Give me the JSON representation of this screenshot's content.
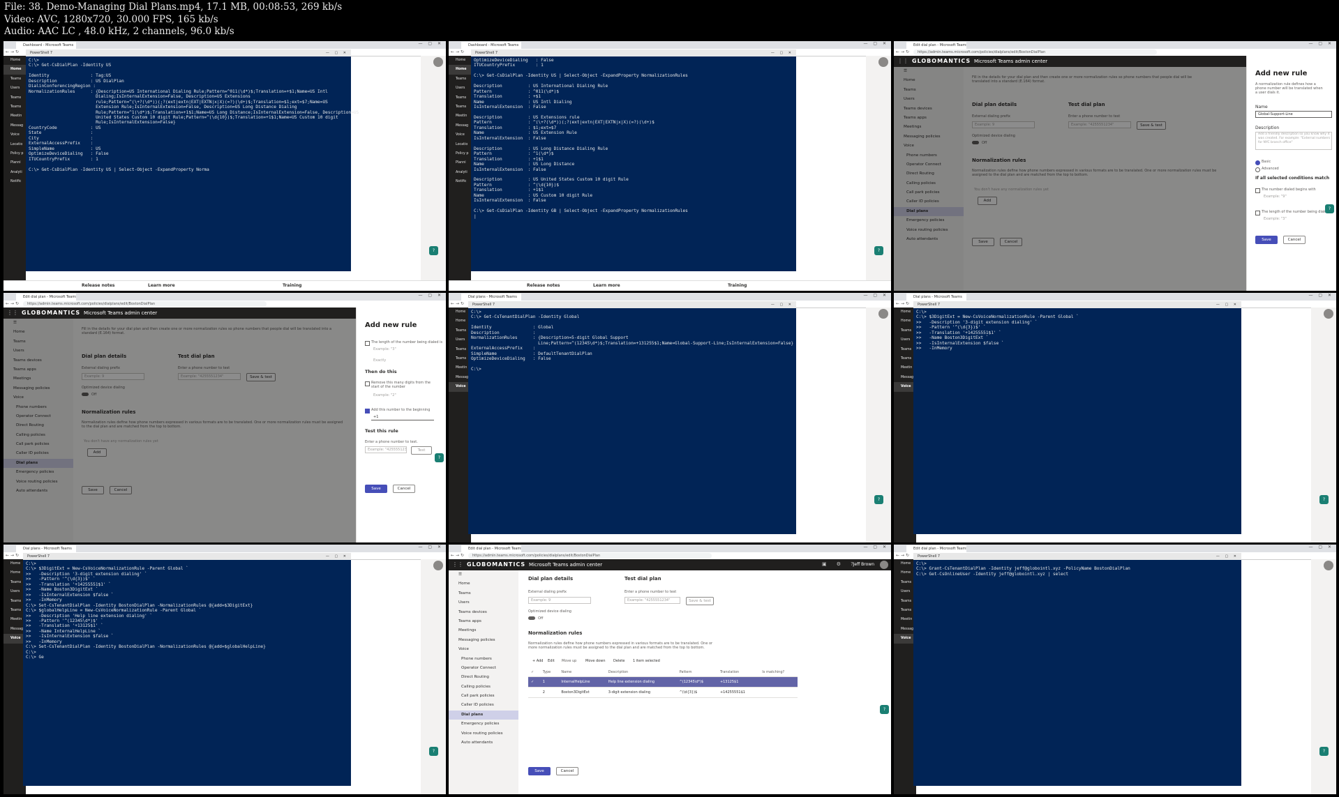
{
  "file_info": {
    "line1": "File: 38. Demo-Managing Dial Plans.mp4, 17.1 MB, 00:08:53, 269 kb/s",
    "line2": "Video: AVC, 1280x720, 30.000 FPS, 165 kb/s",
    "line3": "Audio: AAC LC , 48.0 kHz, 2 channels, 96.0 kb/s"
  },
  "browser": {
    "tab_dashboard": "Dashboard - Microsoft Teams",
    "tab_edit": "Edit dial plan - Microsoft Teams",
    "tab_dialplans": "Dial plans - Microsoft Teams",
    "url": "https://admin.teams.microsoft.com/policies/dialplans/edit/BostonDialPlan",
    "powershell_tab": "PowerShell 7"
  },
  "teams": {
    "brand": "GLOBOMANTICS",
    "app_title": "Microsoft Teams admin center",
    "user": "Jeff Brown"
  },
  "sidebar_items": [
    "Home",
    "Teams",
    "Users",
    "Teams devices",
    "Teams apps",
    "Meetings",
    "Messaging policies",
    "Voice",
    "Phone numbers",
    "Operator Connect",
    "Direct Routing",
    "Calling policies",
    "Call park policies",
    "Caller ID policies",
    "Dial plans",
    "Emergency policies",
    "Voice routing policies",
    "Auto attendants"
  ],
  "ps_left_items": [
    "Home",
    "Teams",
    "Users",
    "Teams",
    "Teams",
    "Meetin",
    "Messag",
    "Voice",
    "Locatio",
    "Policy p",
    "Planni",
    "Analyti",
    "Notific"
  ],
  "bottom_links": {
    "release_notes": "Release notes",
    "learn_more": "Learn more",
    "training": "Training"
  },
  "ps1": "C:\\>\nC:\\> Get-CsDialPlan -Identity US\n\nIdentity                : Tag:US\nDescription             : US DialPlan\nDialinConferencingRegion :\nNormalizationRules      : {Description=US International Dialing Rule;Pattern=^011(\\d*)$;Translation=+$1;Name=US Intl\n                          Dialing;IsInternalExtension=False, Description=US Extensions\n                          rule;Pattern=^(\\+?(\\d*))(;?(ext|extn|EXT|EXTN|x|X)(=?)(\\d+)$;Translation=$1;ext=$7;Name=US\n                          Extension Rule;IsInternalExtension=False, Description=US Long Distance Dialing\n                          Rule;Pattern=^1(\\d*)$;Translation=+1$1;Name=US Long Distance;IsInternalExtension=False, Description=US\n                          United States Custom 10 digit Rule;Pattern=^(\\d{10})$;Translation=+1$1;Name=US Custom 10 digit\n                          Rule;IsInternalExtension=False}\nCountryCode             : US\nState                   :\nCity                    :\nExternalAccessPrefix    :\nSimpleName              : US\nOptimizeDeviceDialing   : False\nITUCountryPrefix        : 1\n\nC:\\> Get-CsDialPlan -Identity US | Select-Object -ExpandProperty Norma",
  "ps2": "OptimizeDeviceDialing   : False\nITUCountryPrefix        : 1\n\nC:\\> Get-CsDialPlan -Identity US | Select-Object -ExpandProperty NormalizationRules\n\nDescription          : US International Dialing Rule\nPattern              : ^011(\\d*)$\nTranslation          : +$1\nName                 : US Intl Dialing\nIsInternalExtension  : False\n\nDescription          : US Extensions rule\nPattern              : ^(\\+?(\\d*))(;?(ext|extn|EXT|EXTN|x|X)(=?)(\\d+)$\nTranslation          : $1;ext=$7\nName                 : US Extension Rule\nIsInternalExtension  : False\n\nDescription          : US Long Distance Dialing Rule\nPattern              : ^1(\\d*)$\nTranslation          : +1$1\nName                 : US Long Distance\nIsInternalExtension  : False\n\nDescription          : US United States Custom 10 digit Rule\nPattern              : ^(\\d{10})$\nTranslation          : +1$1\nName                 : US Custom 10 digit Rule\nIsInternalExtension  : False\n\nC:\\> Get-CsDialPlan -Identity GB | Select-Object -ExpandProperty NormalizationRules\n|",
  "ps5": "C:\\>\nC:\\> Get-CsTenantDialPlan -Identity Global\n\nIdentity                : Global\nDescription             :\nNormalizationRules      : {Description=5-digit Global Support\n                          Line;Pattern=^(12345\\d*)$;Translation=+131255$1;Name=Global-Support-Line;IsInternalExtension=False}\nExternalAccessPrefix    :\nSimpleName              : DefaultTenantDialPlan\nOptimizeDeviceDialing   : False\n\nC:\\>",
  "ps6": "C:\\>\nC:\\> $3DigitExt = New-CsVoiceNormalizationRule -Parent Global `\n>>   -Description '3-digit extension dialing' `\n>>   -Pattern '^(\\d{3})$' `\n>>   -Translation '+14255551$1' `\n>>   -Name Boston3DigitExt `\n>>   -IsInternalExtension $false `\n>>   -InMemory",
  "ps7": "C:\\>\nC:\\> $3DigitExt = New-CsVoiceNormalizationRule -Parent Global `\n>>   -Description '3-digit extension dialing' `\n>>   -Pattern '^(\\d{3})$' `\n>>   -Translation '+14255551$1' `\n>>   -Name Boston3DigitExt `\n>>   -IsInternalExtension $false `\n>>   -InMemory\nC:\\> Set-CsTenantDialPlan -Identity BostonDialPlan -NormalizationRules @{add=$3DigitExt}\nC:\\> $globalHelpLine = New-CsVoiceNormalizationRule -Parent Global `\n>>   -Description 'Help line extension dialing' `\n>>   -Pattern '^(12345\\d*)$' `\n>>   -Translation '+13125$1' `\n>>   -Name InternalHelpLine `\n>>   -IsInternalExtension $false `\n>>   -InMemory\nC:\\> Set-CsTenantDialPlan -Identity BostonDialPlan -NormalizationRules @{add=$globalHelpLine}\nC:\\>\nC:\\> Ge",
  "ps9": "C:\\>\nC:\\> Grant-CsTenantDialPlan -Identity jeff@globointl.xyz -PolicyName BostonDialPlan\nC:\\> Get-CsOnlineUser -Identity jeff@globointl.xyz | select",
  "admin": {
    "intro": "Fill in the details for your dial plan and then create one or more normalization rules so phone numbers that people dial will be translated into a standard (E.164) format.",
    "learn_more": "Learn more",
    "dial_plan_details": "Dial plan details",
    "ext_prefix_label": "External dialing prefix",
    "ext_prefix_placeholder": "Example: 9",
    "optimized_label": "Optimized device dialing",
    "off": "Off",
    "test_dial_plan": "Test dial plan",
    "enter_phone": "Enter a phone number to test",
    "phone_placeholder": "Example: \"4255551234\"",
    "save_test": "Save & test",
    "normalization_rules": "Normalization rules",
    "norm_desc": "Normalization rules define how phone numbers expressed in various formats are to be translated. One or more normalization rules must be assigned to the dial plan and are matched from the top to bottom.",
    "no_rules": "You don't have any normalization rules yet",
    "add": "Add",
    "save": "Save",
    "cancel": "Cancel"
  },
  "panel": {
    "title": "Add new rule",
    "desc": "A normalization rule defines how a phone number will be translated when a user dials it.",
    "name_label": "Name",
    "name_value": "Global-Support-Line",
    "description_label": "Description",
    "description_placeholder": "Add a friendly description so you know why it was created. For example: \"External numbers for NYC branch office\"",
    "basic": "Basic",
    "advanced": "Advanced",
    "if_all": "If all selected conditions match",
    "begins_with": "The number dialed begins with",
    "begins_ph": "Example: \"9\"",
    "length_is": "The length of the number being dialed is",
    "length_ph": "Example: \"3\"",
    "exactly": "Exactly",
    "then_do": "Then do this",
    "remove_digits": "Remove this many digits from the start of the number",
    "remove_ph": "Example: \"2\"",
    "add_number": "Add this number to the beginning",
    "add_value": "+1",
    "test_rule": "Test this rule",
    "enter_test": "Enter a phone number to test.",
    "test_ph": "Example: \"4255551234\"",
    "test_btn": "Test",
    "save": "Save",
    "cancel": "Cancel"
  },
  "rules_table": {
    "toolbar": {
      "add": "+ Add",
      "edit": "Edit",
      "move_up": "Move up",
      "move_down": "Move down",
      "delete": "Delete",
      "selected": "1 item selected"
    },
    "headers": [
      "Type",
      "Name",
      "Description",
      "Pattern",
      "Translation",
      "Is matching?"
    ],
    "rows": [
      {
        "num": "1",
        "name": "InternalHelpLine",
        "desc": "Help line extension dialing",
        "pattern": "^(12345\\d*)$",
        "trans": "+13125$1"
      },
      {
        "num": "2",
        "name": "Boston3DigitExt",
        "desc": "3-digit extension dialing",
        "pattern": "^(\\d{3})$",
        "trans": "+14255551$1"
      }
    ]
  }
}
